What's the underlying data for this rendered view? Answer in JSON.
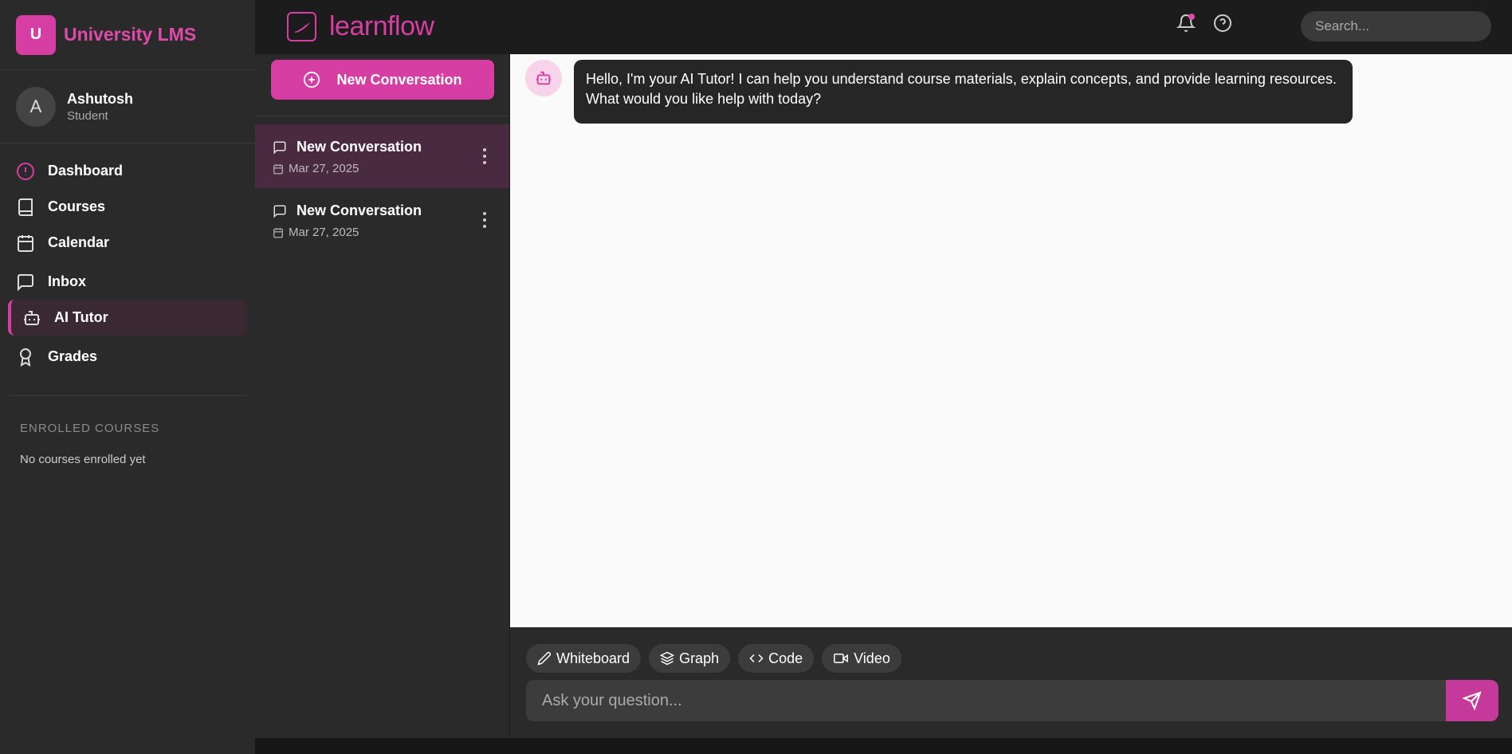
{
  "brand": {
    "badge": "U",
    "name": "University LMS"
  },
  "user": {
    "initial": "A",
    "name": "Ashutosh",
    "role": "Student"
  },
  "nav": [
    {
      "label": "Dashboard",
      "icon": "alert-circle-icon"
    },
    {
      "label": "Courses",
      "icon": "book-icon"
    },
    {
      "label": "Calendar",
      "icon": "calendar-icon"
    },
    {
      "label": "Inbox",
      "icon": "message-square-icon"
    },
    {
      "label": "AI Tutor",
      "icon": "bot-icon",
      "active": true
    },
    {
      "label": "Grades",
      "icon": "award-icon"
    }
  ],
  "enrolled": {
    "title": "ENROLLED COURSES",
    "empty": "No courses enrolled yet"
  },
  "topbar": {
    "logo_text": "learnflow",
    "search_placeholder": "Search..."
  },
  "conversations": {
    "new_button": "New Conversation",
    "items": [
      {
        "title": "New Conversation",
        "date": "Mar 27, 2025",
        "active": true
      },
      {
        "title": "New Conversation",
        "date": "Mar 27, 2025",
        "active": false
      }
    ]
  },
  "chat": {
    "bot_message": "Hello, I'm your AI Tutor! I can help you understand course materials, explain concepts, and provide learning resources. What would you like help with today?"
  },
  "composer": {
    "tools": [
      "Whiteboard",
      "Graph",
      "Code",
      "Video"
    ],
    "placeholder": "Ask your question..."
  },
  "colors": {
    "accent": "#d63ea3",
    "sidebar_bg": "#2a2a2a",
    "chat_bg": "#fafafa"
  }
}
